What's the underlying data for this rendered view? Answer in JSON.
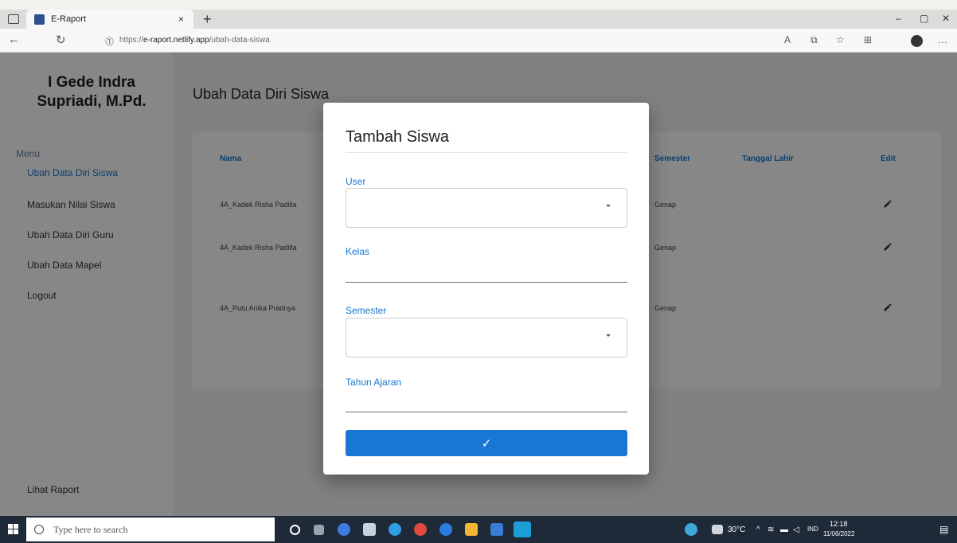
{
  "browser": {
    "tab_title": "E-Raport",
    "tab_close": "×",
    "new_tab": "+",
    "url_prefix": "https://",
    "url_host": "e-raport.netlify.app",
    "url_path": "/ubah-data-siswa",
    "window_controls": {
      "minimize": "–",
      "maximize": "▢",
      "close": "✕"
    },
    "toolbar_icons": [
      "read-aloud-icon",
      "tab-actions-icon",
      "favorites-icon",
      "collections-icon",
      "profile-icon",
      "more-icon"
    ]
  },
  "sidebar": {
    "user_name": "I Gede Indra Supriadi, M.Pd.",
    "menu_title": "Menu",
    "items": [
      {
        "label": "Ubah Data Diri Siswa",
        "active": true
      },
      {
        "label": "Masukan Nilai Siswa",
        "active": false
      },
      {
        "label": "Ubah Data Diri Guru",
        "active": false
      },
      {
        "label": "Ubah Data Mapel",
        "active": false
      },
      {
        "label": "Logout",
        "active": false
      }
    ],
    "footer_link": "Lihat Raport"
  },
  "main": {
    "title": "Ubah Data Diri Siswa",
    "table": {
      "headers": [
        "Nama",
        "Semester",
        "Tanggal Lahir",
        "Edit"
      ],
      "rows": [
        {
          "nama": "4A_Kadek Risha Padilla",
          "semester": "Genap",
          "tanggal_lahir": ""
        },
        {
          "nama": "4A_Kadek Risha Padilla",
          "semester": "Genap",
          "tanggal_lahir": ""
        },
        {
          "nama": "4A_Putu Anika Pradnya",
          "semester": "Genap",
          "tanggal_lahir": ""
        }
      ]
    }
  },
  "dialog": {
    "title": "Tambah Siswa",
    "fields": {
      "user": {
        "label": "User",
        "value": ""
      },
      "kelas": {
        "label": "Kelas",
        "value": ""
      },
      "semester": {
        "label": "Semester",
        "value": ""
      },
      "tahun_ajaran": {
        "label": "Tahun Ajaran",
        "value": ""
      }
    },
    "submit_icon": "✓"
  },
  "taskbar": {
    "search_placeholder": "Type here to search",
    "weather": "30°C",
    "language": "IND",
    "time": "12:18",
    "date": "11/06/2022"
  },
  "colors": {
    "accent": "#1976d2",
    "overlay": "rgba(0,0,0,0.47)",
    "taskbar": "#1e2a38"
  }
}
